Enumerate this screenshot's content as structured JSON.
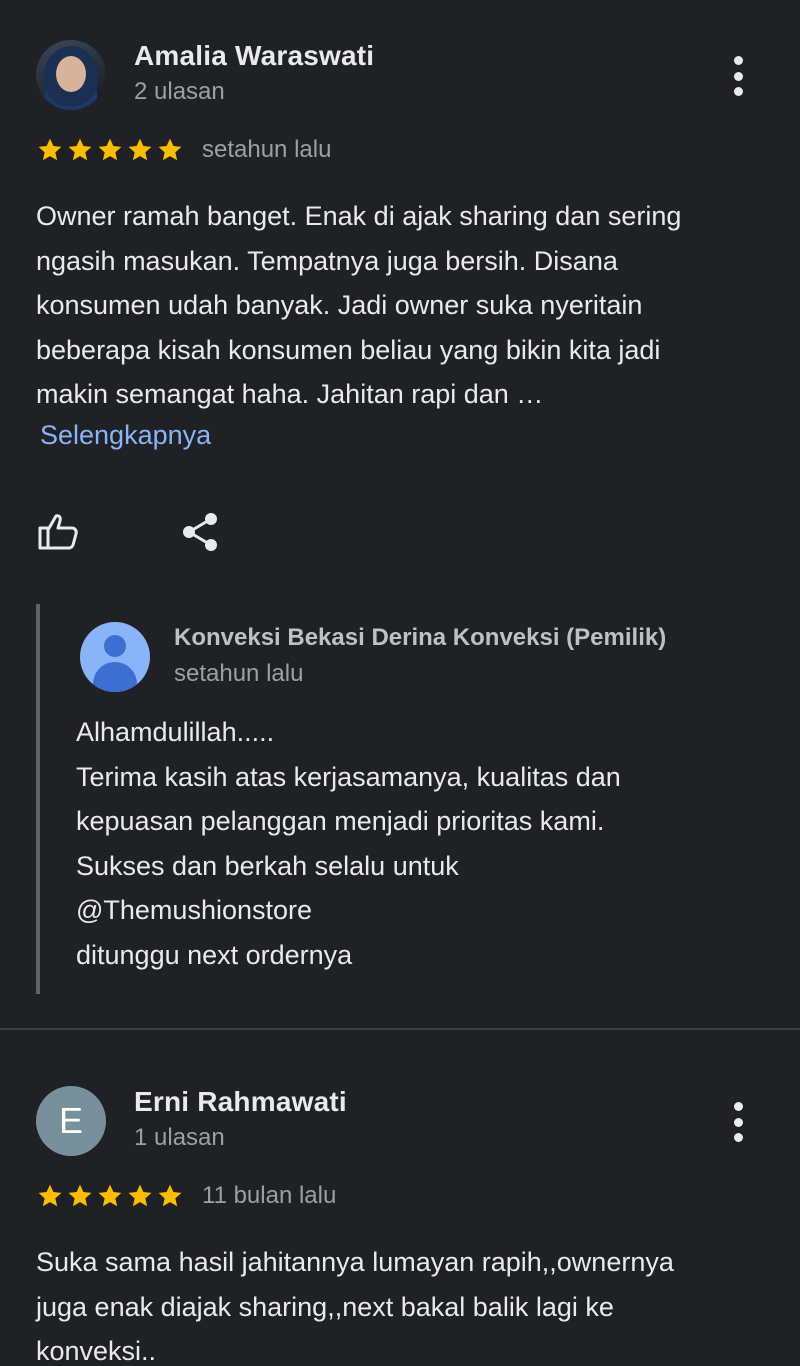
{
  "reviews": [
    {
      "author": "Amalia Waraswati",
      "review_count": "2 ulasan",
      "rating": 5,
      "time": "setahun lalu",
      "text": "Owner ramah banget. Enak di ajak sharing dan sering\nngasih masukan. Tempatnya juga bersih. Disana\nkonsumen udah banyak. Jadi owner suka nyeritain\nbeberapa kisah konsumen beliau yang bikin kita jadi\nmakin semangat haha. Jahitan rapi dan …",
      "more_label": "Selengkapnya",
      "owner_reply": {
        "name": "Konveksi Bekasi Derina Konveksi (Pemilik)",
        "time": "setahun lalu",
        "text": "Alhamdulillah.....\nTerima kasih atas kerjasamanya, kualitas dan\nkepuasan pelanggan menjadi prioritas kami.\nSukses dan berkah selalu untuk\n@Themushionstore\nditunggu next ordernya"
      }
    },
    {
      "author": "Erni Rahmawati",
      "avatar_letter": "E",
      "review_count": "1 ulasan",
      "rating": 5,
      "time": "11 bulan lalu",
      "text": "Suka sama hasil jahitannya lumayan rapih,,ownernya\njuga enak diajak sharing,,next bakal balik lagi ke\nkonveksi.."
    }
  ],
  "icons": {
    "star": "star-icon",
    "like": "thumbs-up-icon",
    "share": "share-icon",
    "more": "more-vert-icon"
  },
  "colors": {
    "background": "#202124",
    "star": "#fbbc04",
    "link": "#8ab4f8",
    "secondary_text": "#9aa0a6"
  }
}
